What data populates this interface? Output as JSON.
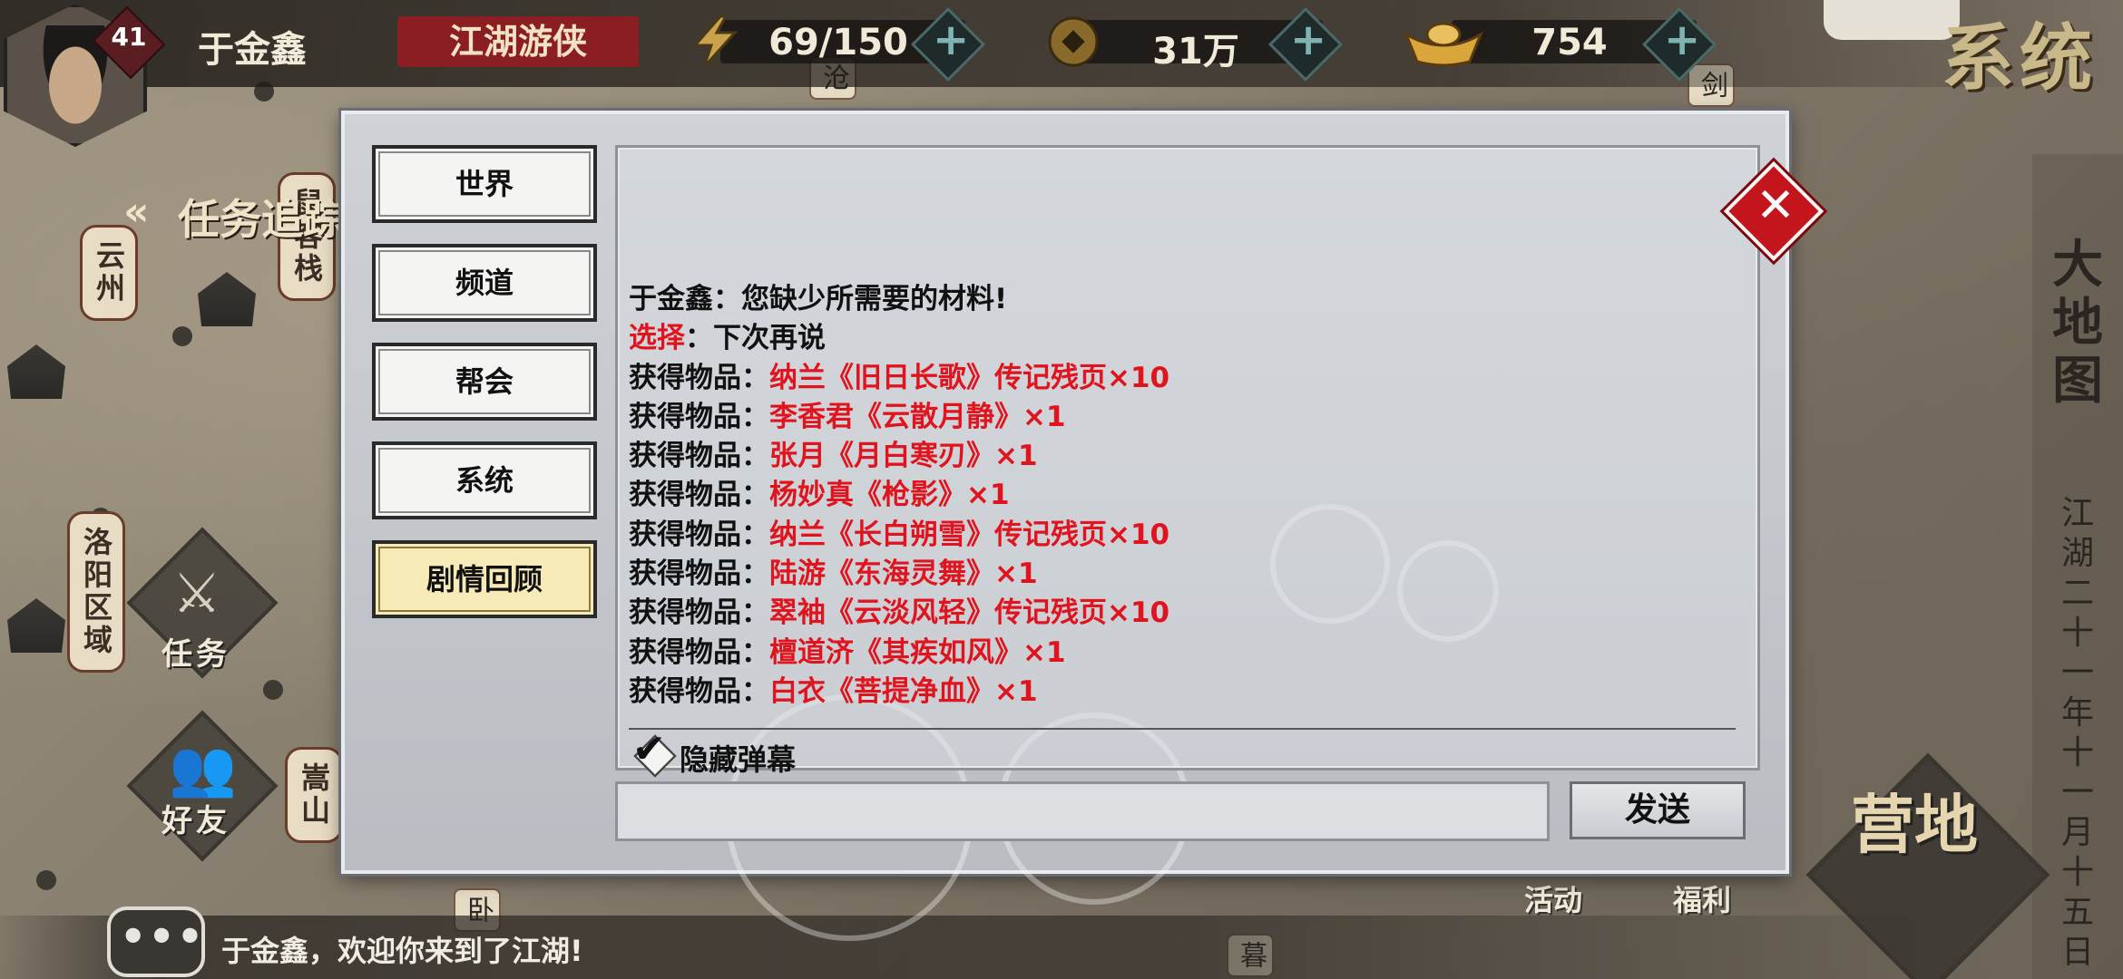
{
  "player": {
    "level": "41",
    "name": "于金鑫",
    "title": "江湖游侠"
  },
  "resources": [
    {
      "icon": "lightning-icon",
      "value": "69/150"
    },
    {
      "icon": "copper-coin-icon",
      "value": "31万"
    },
    {
      "icon": "gold-ingot-icon",
      "value": "754"
    }
  ],
  "top_right": {
    "system": "系统"
  },
  "map": {
    "places": [
      "云州",
      "鼠客栈",
      "洛阳区域",
      "嵩山",
      "沧",
      "剑",
      "暮",
      "卧"
    ],
    "quest_track": "任务追踪",
    "quest_button": "任务",
    "friends_button": "好友",
    "activity_button": "活动",
    "welfare_button": "福利",
    "camp_button": "营地",
    "big_map": "大地图",
    "date": "江湖二十一年十一月十五日"
  },
  "chat_bar": {
    "icon": "chat-bubble-icon",
    "text": "于金鑫，欢迎你来到了江湖!"
  },
  "dialog": {
    "tabs": [
      {
        "label": "世界",
        "active": false
      },
      {
        "label": "频道",
        "active": false
      },
      {
        "label": "帮会",
        "active": false
      },
      {
        "label": "系统",
        "active": false
      },
      {
        "label": "剧情回顾",
        "active": true
      }
    ],
    "messages": [
      {
        "prefix": "于金鑫：",
        "prefix_red": false,
        "content": "您缺少所需要的材料!",
        "content_red": false
      },
      {
        "prefix": "选择",
        "prefix_red": true,
        "sep": "：",
        "content": "下次再说",
        "content_red": false
      },
      {
        "prefix": "获得物品：",
        "prefix_red": false,
        "content": "纳兰《旧日长歌》传记残页×10",
        "content_red": true
      },
      {
        "prefix": "获得物品：",
        "prefix_red": false,
        "content": "李香君《云散月静》×1",
        "content_red": true
      },
      {
        "prefix": "获得物品：",
        "prefix_red": false,
        "content": "张月《月白寒刃》×1",
        "content_red": true
      },
      {
        "prefix": "获得物品：",
        "prefix_red": false,
        "content": "杨妙真《枪影》×1",
        "content_red": true
      },
      {
        "prefix": "获得物品：",
        "prefix_red": false,
        "content": "纳兰《长白朔雪》传记残页×10",
        "content_red": true
      },
      {
        "prefix": "获得物品：",
        "prefix_red": false,
        "content": "陆游《东海灵舞》×1",
        "content_red": true
      },
      {
        "prefix": "获得物品：",
        "prefix_red": false,
        "content": "翠袖《云淡风轻》传记残页×10",
        "content_red": true
      },
      {
        "prefix": "获得物品：",
        "prefix_red": false,
        "content": "檀道济《其疾如风》×1",
        "content_red": true
      },
      {
        "prefix": "获得物品：",
        "prefix_red": false,
        "content": "白衣《菩提净血》×1",
        "content_red": true
      }
    ],
    "hide_barrage": {
      "label": "隐藏弹幕",
      "checked": true
    },
    "input": {
      "value": "",
      "placeholder": ""
    },
    "send_label": "发送",
    "close_icon": "close-icon"
  },
  "colors": {
    "accent_red": "#e0141e",
    "title_red": "#8a1e22",
    "active_tab": "#f6eab6"
  }
}
